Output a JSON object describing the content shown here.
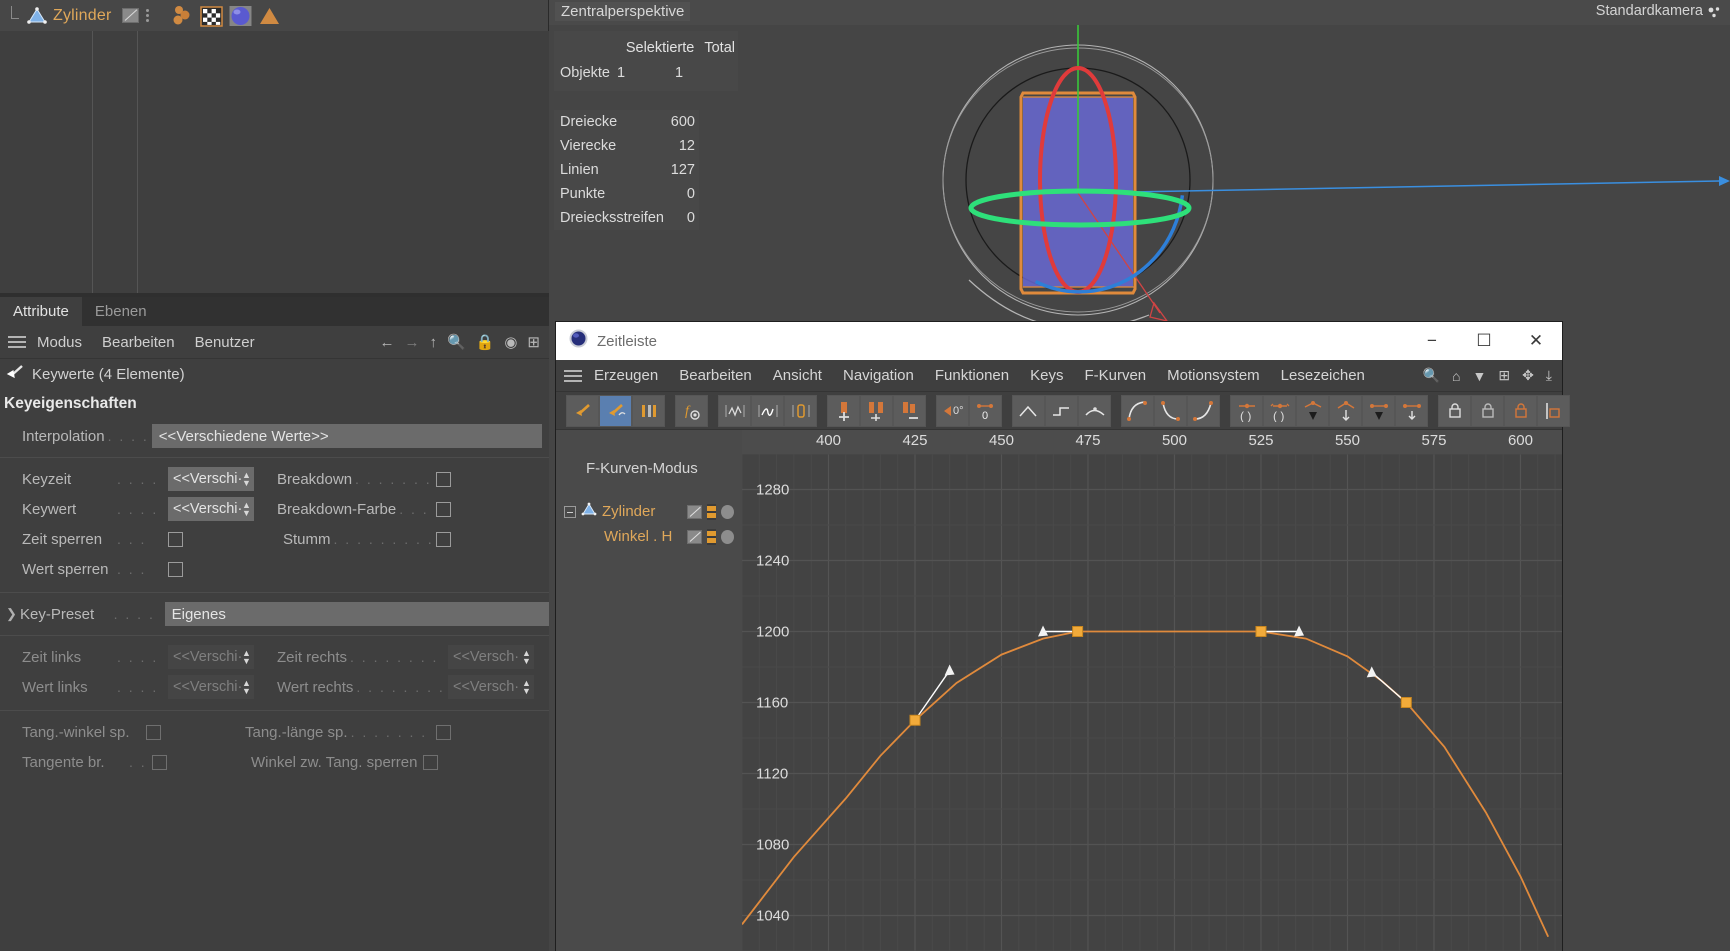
{
  "object_manager": {
    "object_name": "Zylinder",
    "icons": [
      "cone-icon",
      "display-tag-icon",
      "dots-icon",
      "material-chain-icon",
      "checker-tag-icon",
      "sphere-tag-icon",
      "cone-tag-icon"
    ]
  },
  "attribute_manager": {
    "tabs": [
      {
        "label": "Attribute",
        "active": true
      },
      {
        "label": "Ebenen",
        "active": false
      }
    ],
    "menus": [
      "Modus",
      "Bearbeiten",
      "Benutzer"
    ],
    "header": "Keywerte (4 Elemente)",
    "section_title": "Keyeigenschaften",
    "fields": {
      "interpolation_label": "Interpolation",
      "interpolation_value": "<<Verschiedene Werte>>",
      "keyzeit_label": "Keyzeit",
      "keyzeit_value": "<<Verschi·",
      "keywert_label": "Keywert",
      "keywert_value": "<<Verschi·",
      "zeit_sperren_label": "Zeit sperren",
      "wert_sperren_label": "Wert sperren",
      "breakdown_label": "Breakdown",
      "breakdown_farbe_label": "Breakdown-Farbe",
      "stumm_label": "Stumm",
      "key_preset_label": "Key-Preset",
      "key_preset_value": "Eigenes",
      "zeit_links_label": "Zeit links",
      "zeit_links_value": "<<Verschi·",
      "zeit_rechts_label": "Zeit rechts",
      "zeit_rechts_value": "<<Versch·",
      "wert_links_label": "Wert links",
      "wert_links_value": "<<Verschi·",
      "wert_rechts_label": "Wert rechts",
      "wert_rechts_value": "<<Versch·",
      "tang_winkel_sp_label": "Tang.-winkel sp.",
      "tang_laenge_sp_label": "Tang.-länge sp.",
      "tangente_br_label": "Tangente br.",
      "winkel_zw_tang_label": "Winkel zw. Tang. sperren"
    }
  },
  "viewport": {
    "perspective": "Zentralperspektive",
    "camera": "Standardkamera",
    "object_stats": {
      "col_selected": "Selektierte",
      "col_total": "Total",
      "row_label": "Objekte",
      "selected": "1",
      "total": "1"
    },
    "geometry_stats": [
      {
        "label": "Dreiecke",
        "value": "600"
      },
      {
        "label": "Vierecke",
        "value": "12"
      },
      {
        "label": "Linien",
        "value": "127"
      },
      {
        "label": "Punkte",
        "value": "0"
      },
      {
        "label": "Dreiecksstreifen",
        "value": "0"
      }
    ]
  },
  "timeline": {
    "window_title": "Zeitleiste",
    "window_buttons": [
      "minimize-button",
      "maximize-button",
      "close-button"
    ],
    "menus": [
      "Erzeugen",
      "Bearbeiten",
      "Ansicht",
      "Navigation",
      "Funktionen",
      "Keys",
      "F-Kurven",
      "Motionsystem",
      "Lesezeichen"
    ],
    "mode_label": "F-Kurven-Modus",
    "tree": [
      {
        "name": "Zylinder",
        "level": 0,
        "expandable": true
      },
      {
        "name": "Winkel . H",
        "level": 1,
        "expandable": false
      }
    ],
    "accent_color": "#e09a30",
    "curve_color": "#e08a3c",
    "selection_color": "#5a7fb0"
  },
  "chart_data": {
    "type": "line",
    "title": "F-Kurven-Modus",
    "xlabel": "",
    "ylabel": "",
    "xlim": [
      375,
      612
    ],
    "ylim": [
      1020,
      1300
    ],
    "x_ticks": [
      400,
      425,
      450,
      475,
      500,
      525,
      550,
      575,
      600
    ],
    "y_ticks": [
      1280,
      1240,
      1200,
      1160,
      1120,
      1080,
      1040
    ],
    "grid": true,
    "legend": "none",
    "series": [
      {
        "name": "Winkel . H",
        "color": "#e08a3c",
        "keyframes": [
          {
            "frame": 425,
            "value": 1150
          },
          {
            "frame": 472,
            "value": 1200
          },
          {
            "frame": 525,
            "value": 1200
          },
          {
            "frame": 567,
            "value": 1160
          }
        ],
        "tangent_handles": [
          {
            "frame": 435,
            "value": 1178
          },
          {
            "frame": 462,
            "value": 1200
          },
          {
            "frame": 536,
            "value": 1200
          },
          {
            "frame": 557,
            "value": 1177
          }
        ],
        "path_samples": [
          {
            "frame": 375,
            "value": 1035
          },
          {
            "frame": 390,
            "value": 1073
          },
          {
            "frame": 405,
            "value": 1106
          },
          {
            "frame": 415,
            "value": 1130
          },
          {
            "frame": 425,
            "value": 1150
          },
          {
            "frame": 437,
            "value": 1171
          },
          {
            "frame": 450,
            "value": 1187
          },
          {
            "frame": 462,
            "value": 1196
          },
          {
            "frame": 472,
            "value": 1200
          },
          {
            "frame": 500,
            "value": 1200
          },
          {
            "frame": 525,
            "value": 1200
          },
          {
            "frame": 538,
            "value": 1196
          },
          {
            "frame": 550,
            "value": 1186
          },
          {
            "frame": 560,
            "value": 1172
          },
          {
            "frame": 567,
            "value": 1160
          },
          {
            "frame": 578,
            "value": 1135
          },
          {
            "frame": 590,
            "value": 1098
          },
          {
            "frame": 600,
            "value": 1062
          },
          {
            "frame": 608,
            "value": 1028
          }
        ]
      }
    ]
  }
}
